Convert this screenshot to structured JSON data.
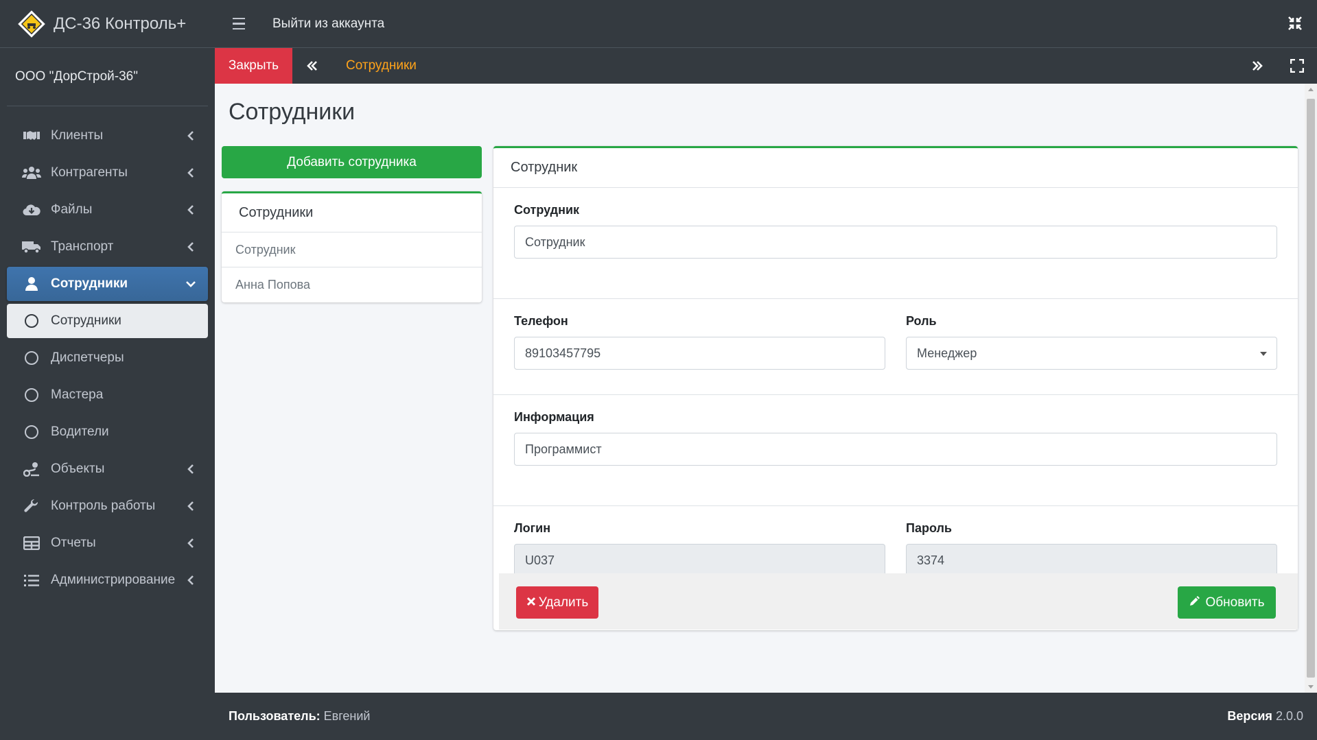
{
  "brand": {
    "title": "ДС-36 Контроль+",
    "logo_icon": "roadworks-diamond-icon"
  },
  "company": "ООО \"ДорСтрой-36\"",
  "sidebar": {
    "items": [
      {
        "label": "Клиенты",
        "icon": "handshake-icon"
      },
      {
        "label": "Контрагенты",
        "icon": "users-icon"
      },
      {
        "label": "Файлы",
        "icon": "cloud-download-icon"
      },
      {
        "label": "Транспорт",
        "icon": "truck-icon"
      },
      {
        "label": "Сотрудники",
        "icon": "user-icon",
        "active": true
      },
      {
        "label": "Сотрудники",
        "sub": true,
        "selected": true
      },
      {
        "label": "Диспетчеры",
        "sub": true
      },
      {
        "label": "Мастера",
        "sub": true
      },
      {
        "label": "Водители",
        "sub": true
      },
      {
        "label": "Объекты",
        "icon": "route-icon"
      },
      {
        "label": "Контроль работы",
        "icon": "wrench-icon"
      },
      {
        "label": "Отчеты",
        "icon": "table-icon"
      },
      {
        "label": "Администрирование",
        "icon": "list-icon"
      }
    ]
  },
  "topbar": {
    "logout": "Выйти из аккаунта"
  },
  "tabbar": {
    "close": "Закрыть",
    "active_tab": "Сотрудники"
  },
  "main": {
    "title": "Сотрудники",
    "add_button": "Добавить сотрудника",
    "list": {
      "header": "Сотрудники",
      "items": [
        "Сотрудник",
        "Анна Попова"
      ]
    },
    "form": {
      "header": "Сотрудник",
      "employee_label": "Сотрудник",
      "employee_value": "Сотрудник",
      "phone_label": "Телефон",
      "phone_value": "89103457795",
      "role_label": "Роль",
      "role_value": "Менеджер",
      "info_label": "Информация",
      "info_value": "Программист",
      "login_label": "Логин",
      "login_value": "U037",
      "password_label": "Пароль",
      "password_value": "3374",
      "delete_button": "Удалить",
      "update_button": "Обновить"
    }
  },
  "footer": {
    "user_label": "Пользователь:",
    "user_name": "Евгений",
    "version_label": "Версия",
    "version_value": "2.0.0"
  },
  "colors": {
    "sidebar": "#343a40",
    "active": "#3c6fa5",
    "success": "#28a745",
    "danger": "#dc3545",
    "tab_active": "#ffa31a"
  }
}
